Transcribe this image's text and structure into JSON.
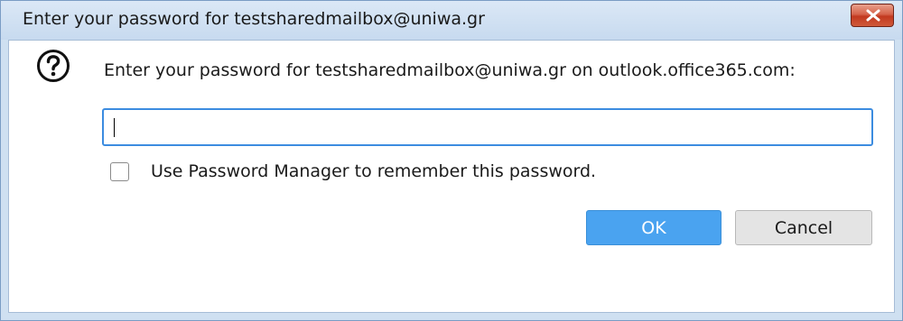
{
  "window": {
    "title": "Enter your password for testsharedmailbox@uniwa.gr",
    "close_icon": "close-icon"
  },
  "dialog": {
    "icon": "question-icon",
    "message": "Enter your password for testsharedmailbox@uniwa.gr on outlook.office365.com:",
    "password": {
      "value": "",
      "placeholder": ""
    },
    "remember": {
      "label": "Use Password Manager to remember this password.",
      "checked": false
    },
    "buttons": {
      "ok_label": "OK",
      "cancel_label": "Cancel"
    }
  },
  "colors": {
    "accent": "#4aa3f0",
    "close_button": "#c2391f",
    "frame": "#cfe0f1"
  }
}
